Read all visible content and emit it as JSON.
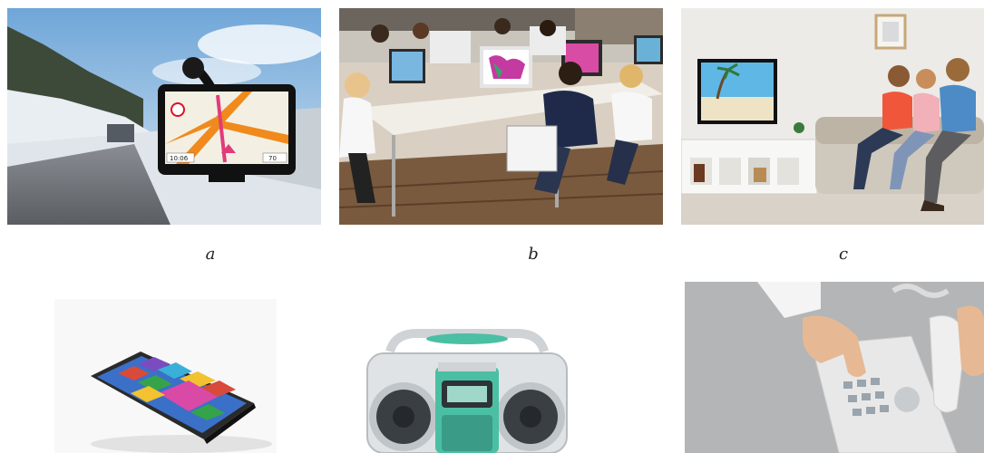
{
  "captions": {
    "a": "a",
    "b": "b",
    "c": "c"
  },
  "gps_screen": {
    "left_readout": "10:06",
    "right_readout": "70"
  }
}
